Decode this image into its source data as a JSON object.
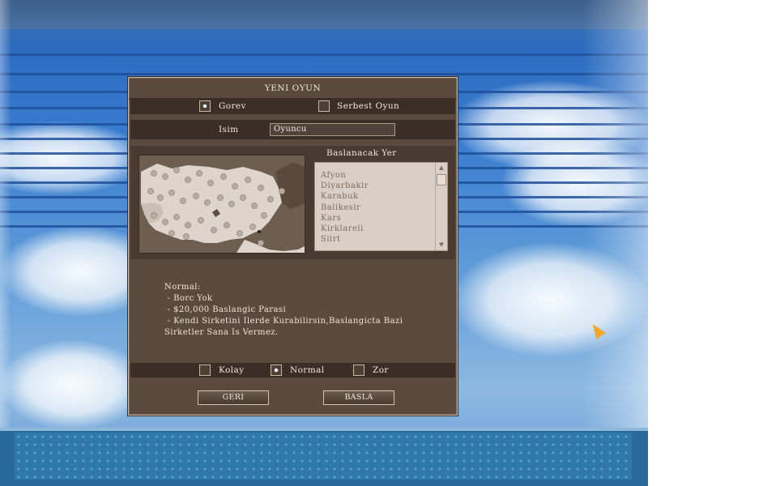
{
  "dialog": {
    "title": "YENI OYUN",
    "mode_options": [
      {
        "label": "Gorev",
        "selected": true
      },
      {
        "label": "Serbest Oyun",
        "selected": false
      }
    ],
    "name_label": "Isim",
    "name_value": "Oyuncu",
    "start_location_label": "Baslanacak Yer",
    "cities": [
      "Afyon",
      "Diyarbakir",
      "Karabuk",
      "Balikesir",
      "Kars",
      "Kirklareli",
      "Siirt"
    ],
    "difficulty_description": "Normal:\n - Borc Yok\n - $20,000 Baslangic Parasi\n - Kendi Sirketini Ilerde Kurabilirsin,Baslangicta Bazi\nSirketler Sana Is Vermez.",
    "difficulty_options": [
      {
        "label": "Kolay",
        "selected": false
      },
      {
        "label": "Normal",
        "selected": true
      },
      {
        "label": "Zor",
        "selected": false
      }
    ],
    "back_button": "GERI",
    "start_button": "BASLA"
  },
  "icons": {
    "map": "turkey-map-icon",
    "cursor": "arrow-cursor-icon",
    "scroll_up": "scroll-up-arrow-icon",
    "scroll_down": "scroll-down-arrow-icon"
  },
  "colors": {
    "dialog_bg": "#5b4a3d",
    "dialog_row": "#3b2e26",
    "sky": "#3a7ed0",
    "list_bg": "#d9cfc6"
  }
}
